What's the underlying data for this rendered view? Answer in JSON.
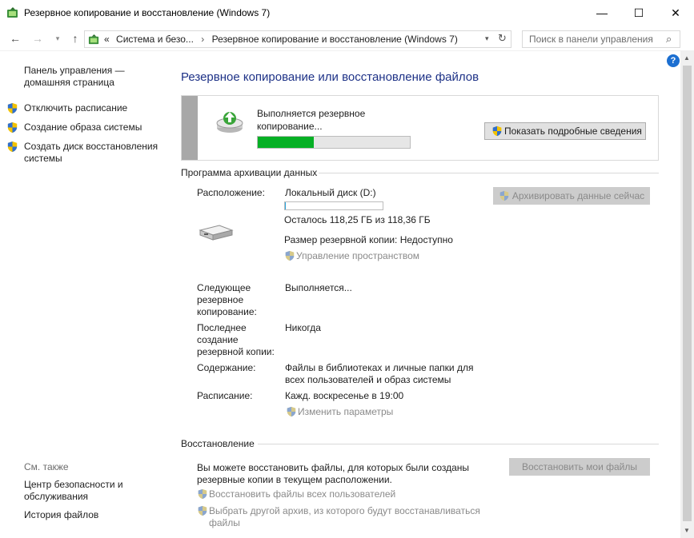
{
  "window": {
    "title": "Резервное копирование и восстановление (Windows 7)",
    "minimize": "—",
    "maximize": "☐",
    "close": "✕"
  },
  "nav": {
    "back": "←",
    "forward": "→",
    "recent": "▾",
    "up": "↑",
    "crumb_prefix": "«",
    "crumb1": "Система и безо...",
    "crumb_sep": "›",
    "crumb2": "Резервное копирование и восстановление (Windows 7)",
    "addr_dropdown": "▾",
    "refresh": "↻",
    "search_placeholder": "Поиск в панели управления",
    "search_icon": "⌕"
  },
  "help": "?",
  "left_pane": {
    "home": "Панель управления — домашняя страница",
    "items": [
      "Отключить расписание",
      "Создание образа системы",
      "Создать диск восстановления системы"
    ],
    "see_also": "См. также",
    "bottom_links": [
      "Центр безопасности и обслуживания",
      "История файлов"
    ]
  },
  "main": {
    "title": "Резервное копирование или восстановление файлов",
    "progress_text": "Выполняется резервное копирование...",
    "progress_fraction": 0.37,
    "details_button": "Показать подробные сведения",
    "backup_section": "Программа архивации данных",
    "backup_now_button": "Архивировать данные сейчас",
    "location_label": "Расположение:",
    "location_value": "Локальный диск (D:)",
    "disk_used_fraction": 0.01,
    "free_space": "Осталось 118,25 ГБ из 118,36 ГБ",
    "backup_size": "Размер резервной копии: Недоступно",
    "manage_space": "Управление пространством",
    "next_label": "Следующее резервное копирование:",
    "next_value": "Выполняется...",
    "last_label": "Последнее создание резервной копии:",
    "last_value": "Никогда",
    "contents_label": "Содержание:",
    "contents_value": "Файлы в библиотеках и личные папки для всех пользователей и образ системы",
    "schedule_label": "Расписание:",
    "schedule_value": "Кажд. воскресенье в 19:00",
    "change_settings": "Изменить параметры",
    "restore_section": "Восстановление",
    "restore_text": "Вы можете восстановить файлы, для которых были созданы резервные копии в текущем расположении.",
    "restore_button": "Восстановить мои файлы",
    "restore_all_users": "Восстановить файлы всех пользователей",
    "select_other": "Выбрать другой архив, из которого будут восстанавливаться файлы"
  },
  "colors": {
    "title_blue": "#1e3287",
    "progress_green": "#06b025",
    "disk_blue": "#26a0da",
    "disabled_text": "#8a8a8a"
  }
}
